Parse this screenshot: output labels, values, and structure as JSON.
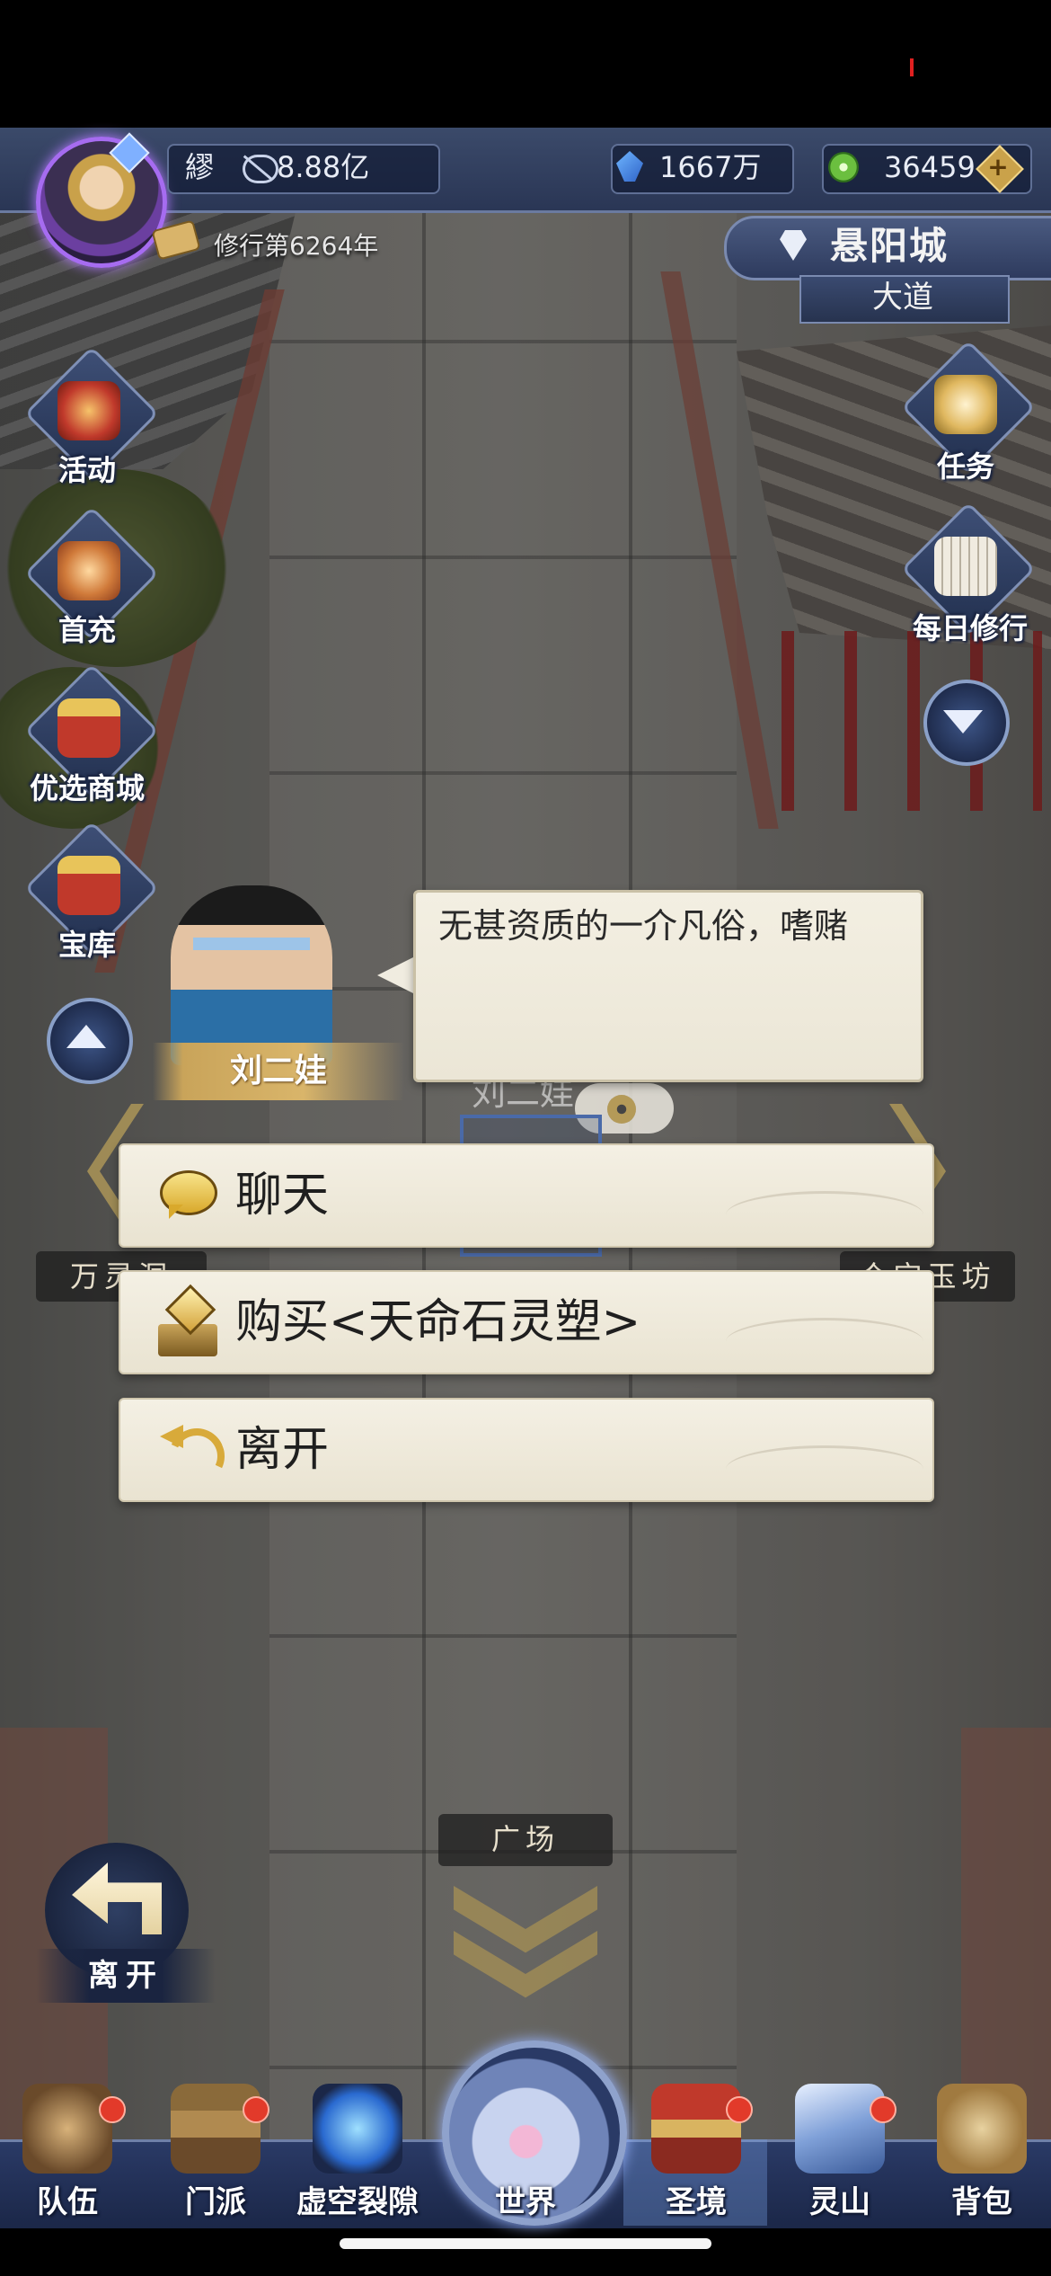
{
  "status_bar": {
    "indicator_color": "#e02020"
  },
  "hud": {
    "player_name": "繆",
    "power_value": "8.88亿",
    "crystals": "1667万",
    "coins": "36459",
    "cultivation_year": "修行第6264年"
  },
  "location": {
    "city": "悬阳城",
    "area": "大道"
  },
  "left_menu": [
    {
      "label": "活动",
      "icon": "lantern-icon"
    },
    {
      "label": "首充",
      "icon": "treasure-bag-icon"
    },
    {
      "label": "优选商城",
      "icon": "gift-box-icon"
    },
    {
      "label": "宝库",
      "icon": "chest-icon"
    }
  ],
  "right_menu": [
    {
      "label": "任务",
      "icon": "scroll-bell-icon"
    },
    {
      "label": "每日修行",
      "icon": "book-icon"
    }
  ],
  "npc": {
    "name": "刘二娃",
    "speech": "无甚资质的一介凡俗，嗜赌",
    "world_label": "刘二娃"
  },
  "signposts": {
    "left": "万灵洞",
    "right": "众宝玉坊",
    "bottom": "广场"
  },
  "options": [
    {
      "label": "聊天",
      "icon": "chat-bubble-icon"
    },
    {
      "label": "购买<天命石灵塑>",
      "icon": "shop-emblem-icon"
    },
    {
      "label": "离开",
      "icon": "return-arrow-icon"
    }
  ],
  "leave_button": {
    "label": "离开"
  },
  "bottom_nav": [
    {
      "label": "队伍",
      "badge": true
    },
    {
      "label": "门派",
      "badge": true
    },
    {
      "label": "虚空裂隙",
      "badge": false
    },
    {
      "label": "世界",
      "badge": false
    },
    {
      "label": "圣境",
      "badge": true
    },
    {
      "label": "灵山",
      "badge": true
    },
    {
      "label": "背包",
      "badge": false
    }
  ],
  "colors": {
    "hud": "#2a3655",
    "accent_gold": "#c9a45a",
    "badge_red": "#e23a2a",
    "parchment": "#f4f0e4"
  }
}
